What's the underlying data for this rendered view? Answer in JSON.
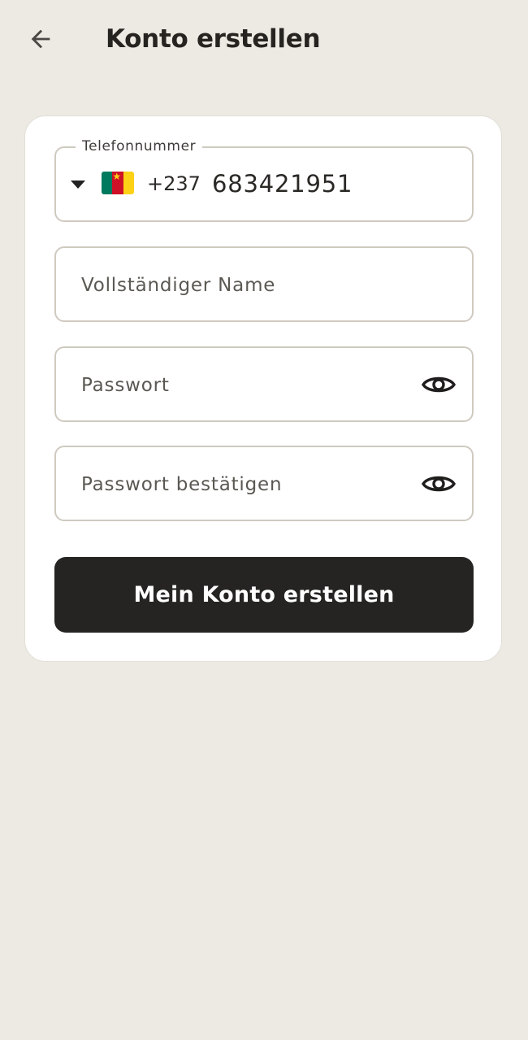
{
  "header": {
    "title": "Konto erstellen",
    "back_icon": "arrow-left-icon"
  },
  "form": {
    "phone": {
      "label": "Telefonnummer",
      "country_flag": "cameroon-flag",
      "dial_code": "+237",
      "value": "683421951"
    },
    "full_name": {
      "placeholder": "Vollständiger Name"
    },
    "password": {
      "placeholder": "Passwort",
      "toggle_icon": "eye-icon"
    },
    "password_confirm": {
      "placeholder": "Passwort bestätigen",
      "toggle_icon": "eye-icon"
    },
    "submit_label": "Mein Konto erstellen"
  },
  "colors": {
    "background": "#edeae3",
    "card": "#ffffff",
    "button": "#252422",
    "border": "#cfcac0"
  }
}
